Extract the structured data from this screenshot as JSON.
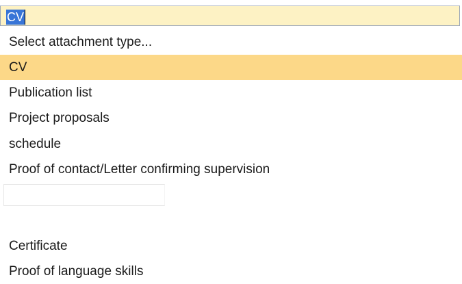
{
  "dropdown": {
    "current_value": "CV",
    "options": [
      {
        "label": "Select attachment type..."
      },
      {
        "label": "CV",
        "selected": true
      },
      {
        "label": "Publication list"
      },
      {
        "label": "Project proposals"
      },
      {
        "label": "schedule"
      },
      {
        "label": "Proof of contact/Letter confirming supervision"
      },
      {
        "label": "Certificate"
      },
      {
        "label": "Proof of language skills"
      }
    ]
  },
  "colors": {
    "select_bg": "#fdf2c4",
    "highlight_bg": "#fcd888",
    "text_selection": "#3875d7"
  }
}
